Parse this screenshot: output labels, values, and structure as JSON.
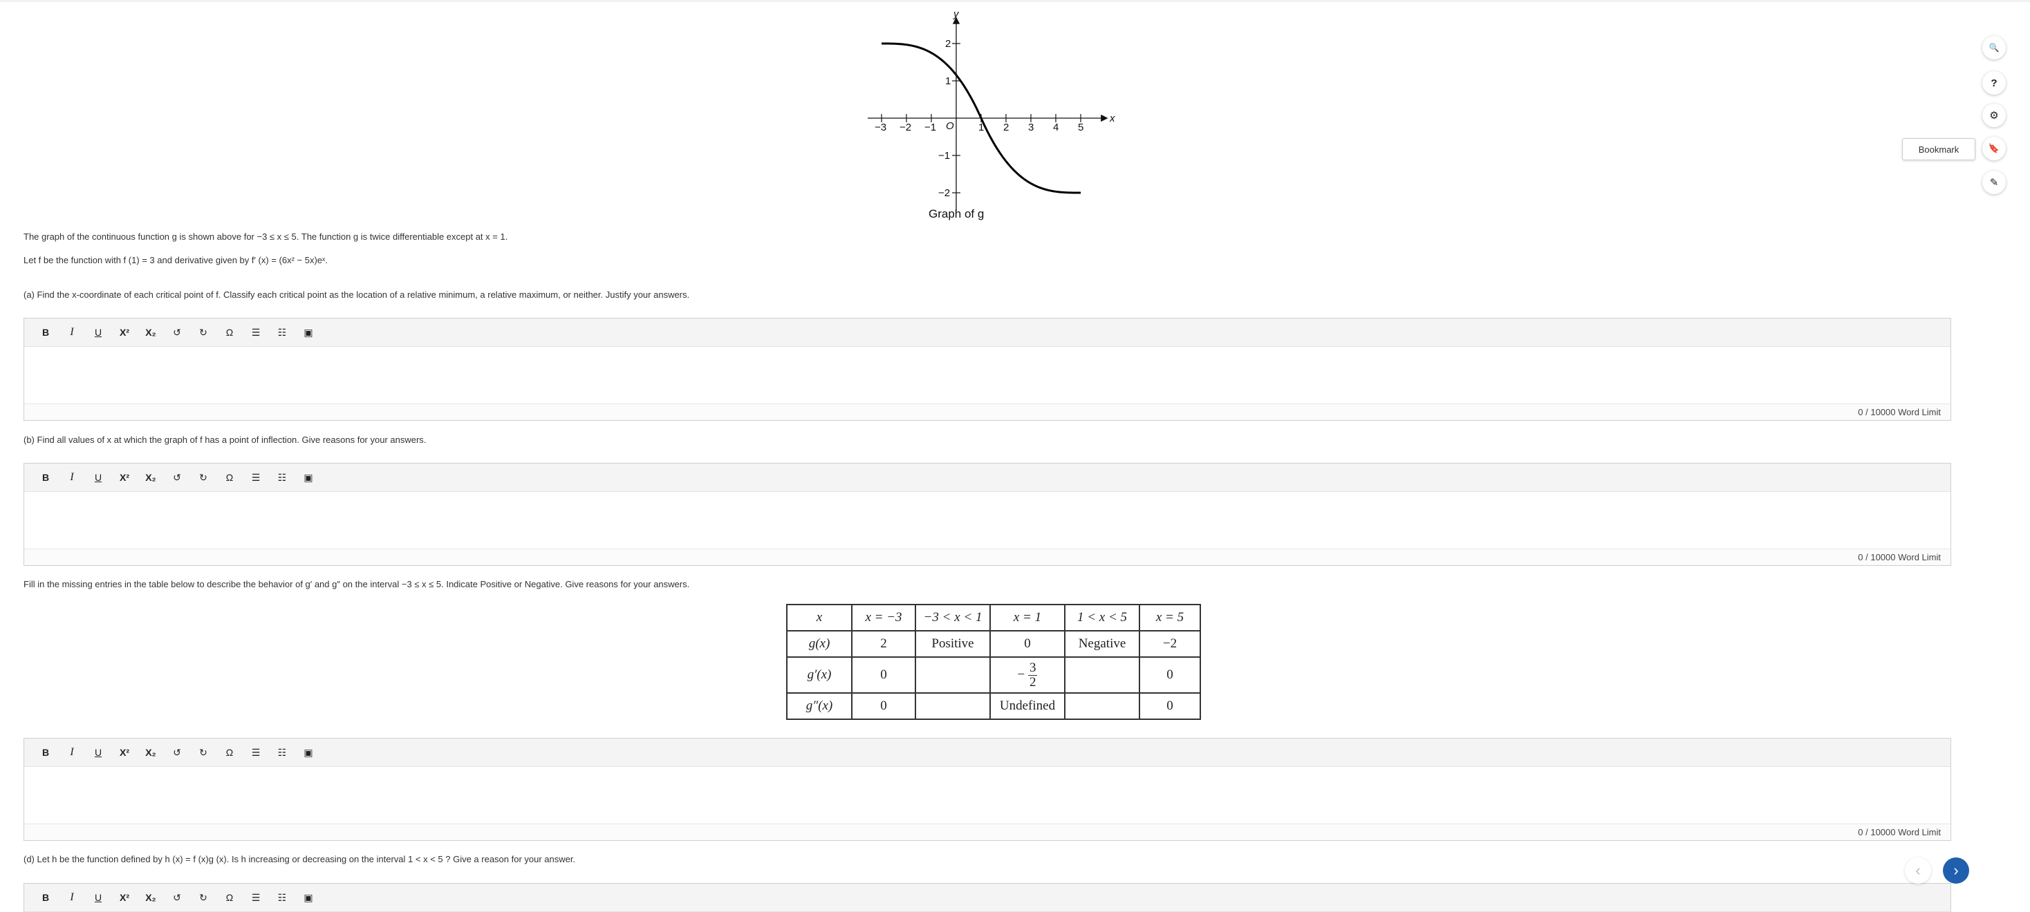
{
  "graph": {
    "x_axis_label": "x",
    "y_axis_label": "y",
    "origin_label": "O",
    "x_ticks": [
      "−3",
      "−2",
      "−1",
      "1",
      "2",
      "3",
      "4",
      "5"
    ],
    "y_ticks": [
      "2",
      "1",
      "−1",
      "−2"
    ],
    "caption": "Graph of g"
  },
  "intro": {
    "line1": "The graph of the continuous function g is shown above for −3 ≤ x ≤ 5. The function g is twice differentiable except at x = 1.",
    "line2": "Let f be the function with f (1) = 3 and derivative given by f′ (x) = (6x² − 5x)eˣ."
  },
  "questions": {
    "a": "(a)  Find the x-coordinate of each critical point of f. Classify each critical point as the location of a relative minimum, a relative maximum, or neither. Justify your answers.",
    "b": "(b)  Find all values of x at which the graph of f has a point of inflection. Give reasons for your answers.",
    "c": "Fill in the missing entries in the table below to describe the behavior of g′ and g″ on the interval −3 ≤ x ≤ 5. Indicate Positive or Negative. Give reasons for your answers.",
    "d": "(d)  Let h be the function defined by h (x) = f (x)g (x). Is h increasing or decreasing on the interval 1 < x < 5 ? Give a reason for your answer."
  },
  "editor": {
    "word_limit": "0 / 10000 Word Limit",
    "toolbar": {
      "bold": "B",
      "italic": "I",
      "underline": "U",
      "superscript": "X²",
      "subscript": "X₂",
      "undo": "↺",
      "redo": "↻",
      "special_char": "Ω",
      "bullet_list": "☰",
      "numbered_list": "☷",
      "image": "▣"
    }
  },
  "table": {
    "header": [
      "x",
      "x = −3",
      "−3 < x < 1",
      "x = 1",
      "1 < x < 5",
      "x = 5"
    ],
    "rows": [
      {
        "label": "g(x)",
        "cells": [
          "2",
          "Positive",
          "0",
          "Negative",
          "−2"
        ]
      },
      {
        "label": "g′(x)",
        "cells": [
          "0",
          "",
          "−3/2",
          "",
          "0"
        ]
      },
      {
        "label": "g″(x)",
        "cells": [
          "0",
          "",
          "Undefined",
          "",
          "0"
        ]
      }
    ],
    "frac_sign": "−",
    "frac_num": "3",
    "frac_den": "2"
  },
  "sidebar": {
    "zoom_icon": "🔍",
    "help_icon": "?",
    "settings_icon": "⚙",
    "bookmark_label": "Bookmark",
    "bookmark_icon": "🔖",
    "pencil_icon": "✎"
  },
  "nav": {
    "prev": "‹",
    "next": "›"
  }
}
